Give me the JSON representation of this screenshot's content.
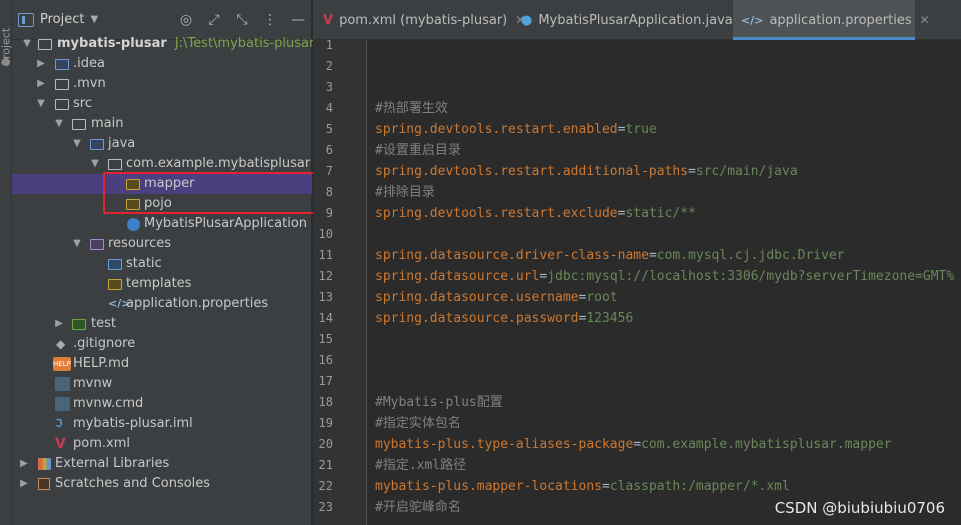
{
  "side_strip": {
    "label": "Project"
  },
  "project_panel": {
    "title": "Project",
    "tree": [
      {
        "label": "mybatis-plusar",
        "path": "J:\\Test\\mybatis-plusar"
      },
      {
        "label": ".idea"
      },
      {
        "label": ".mvn"
      },
      {
        "label": "src"
      },
      {
        "label": "main"
      },
      {
        "label": "java"
      },
      {
        "label": "com.example.mybatisplusar"
      },
      {
        "label": "mapper"
      },
      {
        "label": "pojo"
      },
      {
        "label": "MybatisPlusarApplication"
      },
      {
        "label": "resources"
      },
      {
        "label": "static"
      },
      {
        "label": "templates"
      },
      {
        "label": "application.properties"
      },
      {
        "label": "test"
      },
      {
        "label": ".gitignore"
      },
      {
        "label": "HELP.md"
      },
      {
        "label": "mvnw"
      },
      {
        "label": "mvnw.cmd"
      },
      {
        "label": "mybatis-plusar.iml"
      },
      {
        "label": "pom.xml"
      },
      {
        "label": "External Libraries"
      },
      {
        "label": "Scratches and Consoles"
      }
    ]
  },
  "tabs": [
    {
      "label": "pom.xml (mybatis-plusar)",
      "icon": "V"
    },
    {
      "label": "MybatisPlusarApplication.java",
      "icon": "●"
    },
    {
      "label": "application.properties",
      "icon": "</>"
    }
  ],
  "editor": {
    "line_numbers": [
      "1",
      "2",
      "3",
      "4",
      "5",
      "6",
      "7",
      "8",
      "9",
      "10",
      "11",
      "12",
      "13",
      "14",
      "15",
      "16",
      "17",
      "18",
      "19",
      "20",
      "21",
      "22",
      "23"
    ],
    "lines": [
      {
        "comment": ""
      },
      {
        "comment": ""
      },
      {
        "comment": ""
      },
      {
        "comment": "#热部署生效"
      },
      {
        "key": "spring.devtools.restart.enabled",
        "value": "true"
      },
      {
        "comment": "#设置重启目录"
      },
      {
        "key": "spring.devtools.restart.additional-paths",
        "value": "src/main/java"
      },
      {
        "comment": "#排除目录"
      },
      {
        "key": "spring.devtools.restart.exclude",
        "value": "static/**"
      },
      {
        "comment": ""
      },
      {
        "key": "spring.datasource.driver-class-name",
        "value": "com.mysql.cj.jdbc.Driver"
      },
      {
        "key": "spring.datasource.url",
        "value": "jdbc:mysql://localhost:3306/mydb?serverTimezone=GMT%"
      },
      {
        "key": "spring.datasource.username",
        "value": "root"
      },
      {
        "key": "spring.datasource.password",
        "value": "123456"
      },
      {
        "comment": ""
      },
      {
        "comment": ""
      },
      {
        "comment": ""
      },
      {
        "comment": "#Mybatis-plus配置"
      },
      {
        "comment": "#指定实体包名"
      },
      {
        "key": "mybatis-plus.type-aliases-package",
        "value": "com.example.mybatisplusar.mapper"
      },
      {
        "comment": "#指定.xml路径"
      },
      {
        "key": "mybatis-plus.mapper-locations",
        "value": "classpath:/mapper/*.xml"
      },
      {
        "comment": "#开启驼峰命名"
      }
    ]
  },
  "watermark": "CSDN @biubiubiu0706",
  "colors": {
    "selection": "#4b3f7f",
    "highlight_box": "#e5232f",
    "key": "#cc7832",
    "value": "#6a8759",
    "comment": "#808080"
  }
}
